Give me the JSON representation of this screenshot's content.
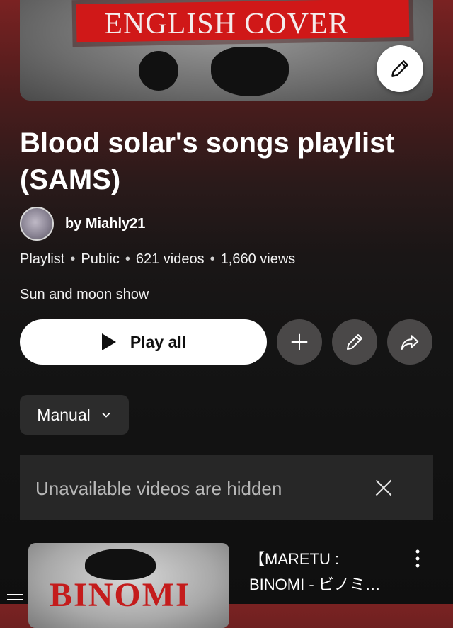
{
  "banner": {
    "text": "ENGLISH COVER",
    "edit_icon": "pencil-icon"
  },
  "playlist": {
    "title": "Blood solar's songs playlist (SAMS)",
    "owner": "by Miahly21",
    "type": "Playlist",
    "visibility": "Public",
    "video_count": "621 videos",
    "views": "1,660 views",
    "description": "Sun and moon show"
  },
  "actions": {
    "play_all": "Play all",
    "add_icon": "plus-icon",
    "edit_icon": "pencil-icon",
    "share_icon": "share-icon"
  },
  "sort": {
    "label": "Manual"
  },
  "notice": {
    "text": "Unavailable videos are hidden"
  },
  "videos": [
    {
      "title": "【MARETU : BINOMI - ビノミ…",
      "thumbnail_text": "BINOMI"
    }
  ],
  "colors": {
    "accent_red": "#d01818",
    "background": "#0f0f0f",
    "surface": "#272727"
  }
}
